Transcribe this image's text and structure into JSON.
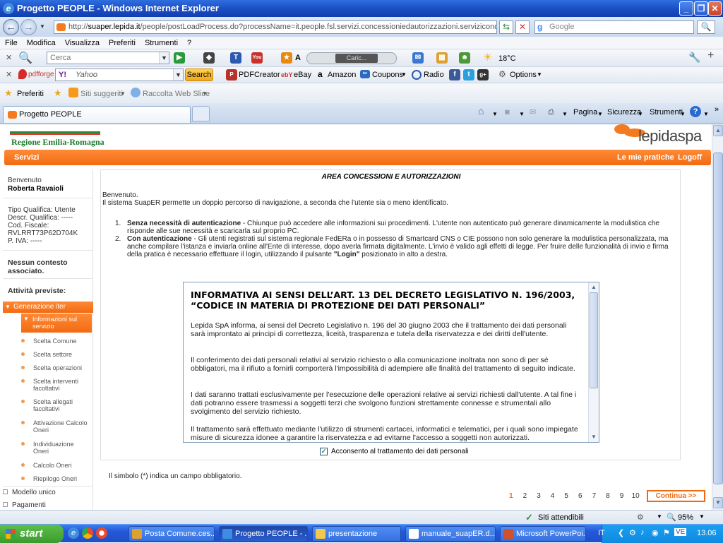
{
  "window": {
    "title": "Progetto PEOPLE - Windows Internet Explorer"
  },
  "address": {
    "url_prefix": "http://",
    "url_host": "suaper.lepida.it",
    "url_path": "/people/postLoadProcess.do?processName=it.people.fsl.servizi.concessioniedautorizzazioni.servizicondivisi.procedin",
    "search_placeholder": "Google"
  },
  "menu": [
    "File",
    "Modifica",
    "Visualizza",
    "Preferiti",
    "Strumenti",
    "?"
  ],
  "toolbar1": {
    "search_placeholder": "Cerca",
    "media_label": "Caric...",
    "weather": "18°C"
  },
  "toolbar2": {
    "pdfforge": "pdfforge",
    "yahoo": "Yahoo",
    "search_btn": "Search",
    "items": [
      "PDFCreator",
      "eBay",
      "Amazon",
      "Coupons",
      "Radio",
      "Options"
    ]
  },
  "favbar": {
    "favorites": "Preferiti",
    "suggested": "Siti suggeriti",
    "webslice": "Raccolta Web Slice"
  },
  "tab": {
    "title": "Progetto PEOPLE"
  },
  "commandbar": {
    "page": "Pagina",
    "security": "Sicurezza",
    "tools": "Strumenti"
  },
  "header": {
    "region_logo": "Regione Emilia-Romagna",
    "lepida_logo": "lepidaspa"
  },
  "nav": {
    "services": "Servizi",
    "my_practices": "Le mie pratiche",
    "logout": "Logoff"
  },
  "sidebar": {
    "welcome": "Benvenuto",
    "user_name": "Roberta Ravaioli",
    "qualifica": "Tipo Qualifica: Utente",
    "descr": "Descr. Qualifica: -----",
    "cf": "Cod. Fiscale:",
    "cf_value": "RVLRRT73P62D704K",
    "piva": "P. IVA: -----",
    "no_context": "Nessun contesto associato.",
    "activities": "Attività previste:",
    "section": "Generazione iter",
    "current": "Informazioni sul servizio",
    "items": [
      "Scelta Comune",
      "Scelta settore",
      "Scelta operazioni",
      "Scelta interventi facoltativi",
      "Scelta allegati facoltativi",
      "Attivazione Calcolo Oneri",
      "Individuazione Oneri",
      "Calcolo Oneri",
      "Riepilogo Oneri"
    ],
    "model": "Modello unico",
    "payments": "Pagamenti"
  },
  "content": {
    "area_title": "AREA CONCESSIONI E AUTORIZZAZIONI",
    "welcome": "Benvenuto.",
    "intro": "Il sistema SuapER permette un doppio percorso di navigazione, a seconda che l'utente sia o meno identificato.",
    "item1_num": "1.",
    "item1_title": "Senza necessità di autenticazione",
    "item1_text": " - Chiunque può accedere alle informazioni sui procedimenti. L'utente non autenticato può generare dinamicamente la modulistica che risponde alle sue necessità e scaricarla sul proprio PC.",
    "item2_num": "2.",
    "item2_title": "Con autenticazione",
    "item2_text": " - Gli utenti registrati sul sistema regionale FedERa o in possesso di Smartcard CNS o CIE possono non solo generare la modulistica personalizzata, ma anche compilare l'istanza e inviarla online all'Ente di interesse, dopo averla firmata digitalmente. L'invio è valido agli effetti di legge. Per fruire delle funzionalità di invio e firma della pratica è necessario effettuare il login, utilizzando il pulsante ",
    "item2_login": "\"Login\"",
    "item2_tail": " posizionato in alto a destra."
  },
  "informativa": {
    "heading": "INFORMATIVA AI SENSI DELL’ART. 13 DEL DECRETO LEGISLATIVO N. 196/2003, “CODICE IN MATERIA DI PROTEZIONE DEI DATI PERSONALI”",
    "p1": "Lepida SpA informa, ai sensi del Decreto Legislativo n. 196 del 30 giugno 2003 che il trattamento dei dati personali sarà improntato ai principi di correttezza, liceità, trasparenza e tutela della riservatezza e dei diritti dell'utente.",
    "p2": "Il conferimento dei dati personali relativi al servizio richiesto o alla comunicazione inoltrata non sono di per sé obbligatori, ma il rifiuto a fornirli comporterà l'impossibilità di adempiere alle finalità del trattamento di seguito indicate.",
    "p3": "I dati saranno trattati esclusivamente per l'esecuzione delle operazioni relative ai servizi richiesti dall'utente. A tal fine i dati potranno essere trasmessi a soggetti terzi che svolgono funzioni strettamente connesse e strumentali allo svolgimento del servizio richiesto.",
    "p4": "Il trattamento sarà effettuato mediante l'utilizzo di strumenti cartacei, informatici e telematici, per i quali sono impiegate misure di sicurezza idonee a garantire la riservatezza e ad evitarne l'accesso a soggetti non autorizzati."
  },
  "consent": {
    "label": "Acconsento al trattamento dei dati personali",
    "checked": true
  },
  "required_note": "Il simbolo (*) indica un campo obbligatorio.",
  "pager": {
    "pages": [
      "1",
      "2",
      "3",
      "4",
      "5",
      "6",
      "7",
      "8",
      "9",
      "10"
    ],
    "current": "1",
    "continue": "Continua >>"
  },
  "status": {
    "trusted": "Siti attendibili",
    "zoom": "95%"
  },
  "taskbar": {
    "start": "start",
    "tasks": [
      "Posta Comune.ces...",
      "Progetto PEOPLE - ...",
      "presentazione",
      "manuale_suapER.d...",
      "Microsoft PowerPoi..."
    ],
    "lang": "IT",
    "clock": "13.06"
  }
}
